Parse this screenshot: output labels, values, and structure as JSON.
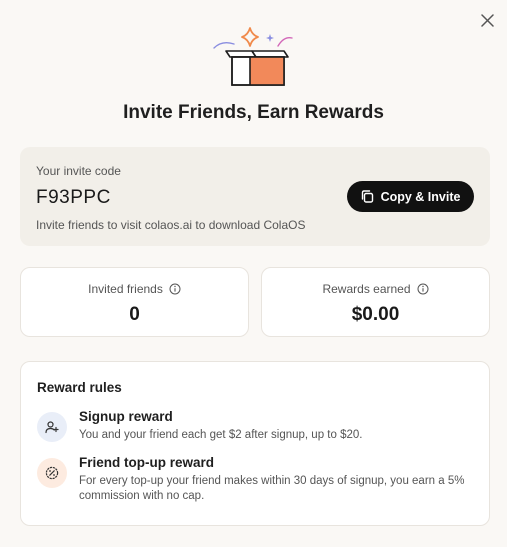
{
  "dialog": {
    "title": "Invite Friends, Earn Rewards"
  },
  "icons": {
    "close": "close-icon",
    "hero": "gift-box-icon",
    "copy": "copy-icon",
    "info": "info-icon",
    "signup": "add-user-icon",
    "topup": "discount-badge-icon"
  },
  "colors": {
    "accent": "#f08a4b",
    "primary_button": "#111111",
    "card_bg": "#f2efe9",
    "signup_icon_bg": "#e9eef8",
    "topup_icon_bg": "#fdebe0"
  },
  "invite": {
    "label": "Your invite code",
    "code": "F93PPC",
    "description": "Invite friends to visit colaos.ai to download ColaOS",
    "copy_button": "Copy & Invite"
  },
  "stats": [
    {
      "label": "Invited friends",
      "value": "0"
    },
    {
      "label": "Rewards earned",
      "value": "$0.00"
    }
  ],
  "rules": {
    "title": "Reward rules",
    "items": [
      {
        "title": "Signup reward",
        "description": "You and your friend each get $2 after signup, up to $20."
      },
      {
        "title": "Friend top-up reward",
        "description": "For every top-up your friend makes within 30 days of signup, you earn a 5% commission with no cap."
      }
    ]
  }
}
